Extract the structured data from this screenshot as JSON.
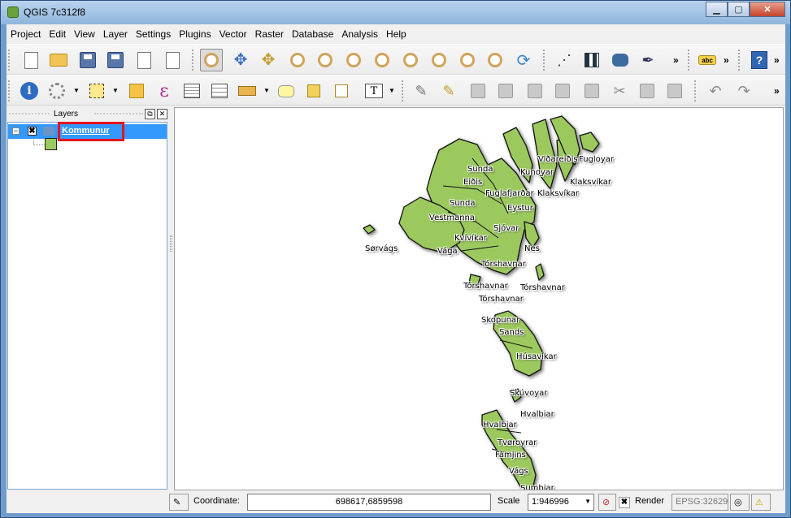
{
  "window": {
    "title": "QGIS 7c312f8"
  },
  "menu": [
    "Project",
    "Edit",
    "View",
    "Layer",
    "Settings",
    "Plugins",
    "Vector",
    "Raster",
    "Database",
    "Analysis",
    "Help"
  ],
  "toolbar": {
    "label_tool": "abc",
    "help_tool": "?",
    "more": "»",
    "text_tool": "T",
    "expression_tool": "ε"
  },
  "layers_panel": {
    "title": "Layers",
    "layer": {
      "name": "Kommunur",
      "visible": true,
      "checkmark": "✖",
      "expander": "−",
      "fill_color": "#9cc95e"
    }
  },
  "map": {
    "fill_color": "#9cc95e",
    "labels": [
      "Viðareiðis",
      "Fugloyar",
      "Sunda",
      "Kunoyar",
      "Eiðis",
      "Klaksvíkar",
      "Fuglafjarðar",
      "Klaksvíkar",
      "Sunda",
      "Eystur",
      "Vestmanna",
      "Sjóvar",
      "Kvívíkar",
      "Sørvágs",
      "Nes",
      "Vága",
      "Tórshavnar",
      "Tórshavnar",
      "Tórshavnar",
      "Tórshavnar",
      "Skopunar",
      "Sands",
      "Húsavíkar",
      "Skúvoyar",
      "Hvalbiar",
      "Hvalbiar",
      "Tvøroyrar",
      "Fámjins",
      "Vágs",
      "Sumbiar"
    ]
  },
  "statusbar": {
    "coordinate_label": "Coordinate:",
    "coordinate_value": "698617,6859598",
    "scale_label": "Scale",
    "scale_value": "1:946996",
    "render_label": "Render",
    "render_check": "✖",
    "crs": "EPSG:32629"
  }
}
